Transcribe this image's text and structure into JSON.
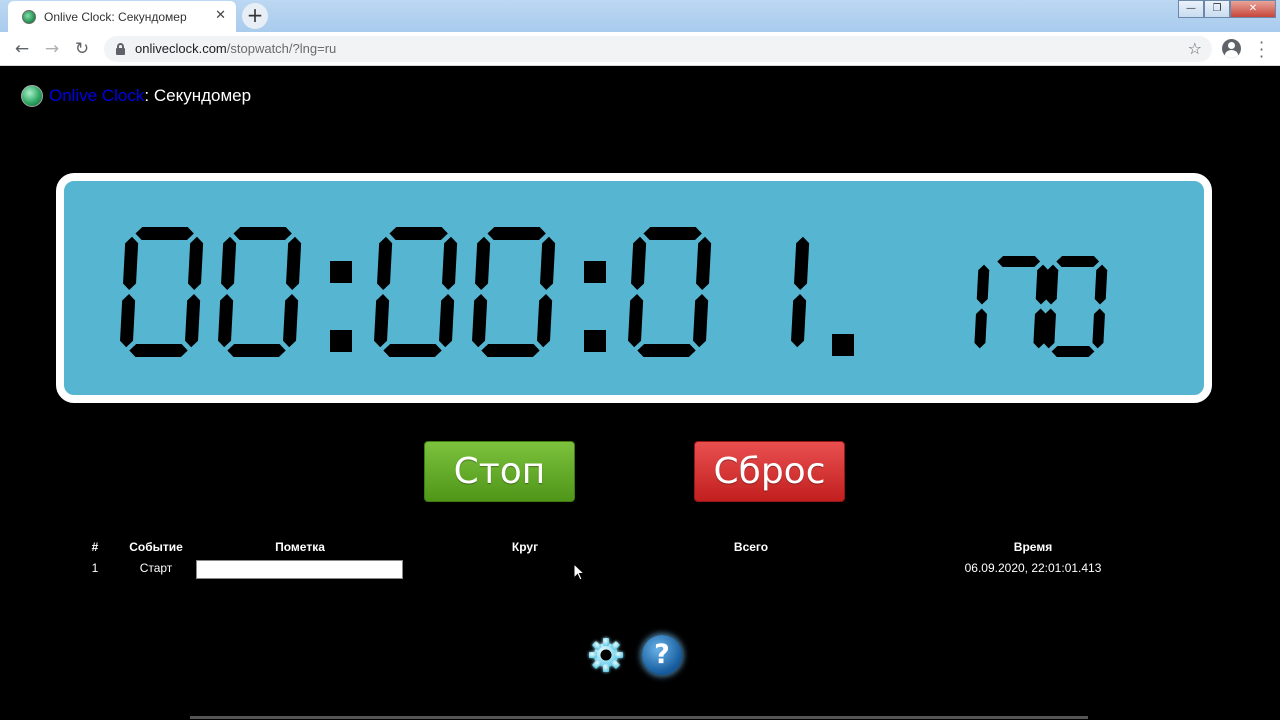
{
  "browser": {
    "tab_title": "Onlive Clock: Секундомер",
    "tab_close": "✕",
    "new_tab": "+",
    "window_controls": [
      "—",
      "❐",
      "✕"
    ],
    "url_host": "onliveclock.com",
    "url_path": "/stopwatch/?lng=ru"
  },
  "header": {
    "site_name": "Onlive Clock",
    "separator": ": ",
    "page_title": "Секундомер"
  },
  "stopwatch": {
    "time": "00:00:01.170",
    "display_color": "#56b6d1",
    "segment_color": "#000000"
  },
  "controls": {
    "stop_label": "Стоп",
    "reset_label": "Сброс",
    "stop_color": "#5ea92a",
    "reset_color": "#d93434"
  },
  "laps": {
    "columns": [
      "#",
      "Событие",
      "Пометка",
      "Круг",
      "Всего",
      "Время"
    ],
    "rows": [
      {
        "num": "1",
        "event": "Старт",
        "note": "",
        "lap": "",
        "total": "",
        "time": "06.09.2020, 22:01:01.413"
      }
    ]
  },
  "footer_icons": [
    "gear-icon",
    "help-icon"
  ],
  "help_glyph": "?"
}
